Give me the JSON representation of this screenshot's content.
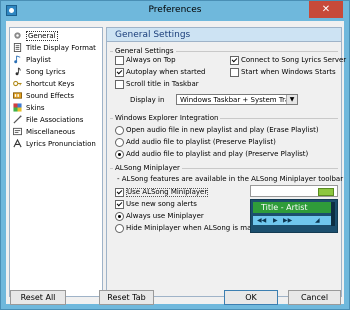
{
  "window": {
    "title": "Preferences"
  },
  "nav": {
    "items": [
      {
        "label": "General",
        "icon": "gear-icon",
        "selected": true
      },
      {
        "label": "Title Display Format",
        "icon": "document-icon"
      },
      {
        "label": "Playlist",
        "icon": "playlist-icon"
      },
      {
        "label": "Song Lyrics",
        "icon": "music-note-icon"
      },
      {
        "label": "Shortcut Keys",
        "icon": "keyboard-icon"
      },
      {
        "label": "Sound Effects",
        "icon": "speaker-icon"
      },
      {
        "label": "Skins",
        "icon": "skin-icon"
      },
      {
        "label": "File Associations",
        "icon": "file-association-icon"
      },
      {
        "label": "Miscellaneous",
        "icon": "misc-icon"
      },
      {
        "label": "Lyrics Pronunciation",
        "icon": "pronunciation-icon"
      }
    ]
  },
  "panel": {
    "title": "General Settings",
    "general": {
      "title": "General Settings",
      "always_on_top": {
        "label": "Always on Top",
        "checked": false
      },
      "autoplay": {
        "label": "Autoplay when started",
        "checked": true
      },
      "scroll_title": {
        "label": "Scroll title in Taskbar",
        "checked": false
      },
      "connect_lyrics": {
        "label": "Connect to Song Lyrics Server",
        "checked": true
      },
      "start_windows": {
        "label": "Start when Windows Starts",
        "checked": false
      },
      "display_label": "Display in",
      "display_value": "Windows Taskbar + System Tray"
    },
    "explorer": {
      "title": "Windows Explorer Integration",
      "options": [
        {
          "label": "Open audio file in new playlist and play (Erase Playlist)",
          "checked": false
        },
        {
          "label": "Add audio file to playlist (Preserve Playlist)",
          "checked": false
        },
        {
          "label": "Add audio file to playlist and play (Preserve Playlist)",
          "checked": true
        }
      ]
    },
    "miniplayer": {
      "title": "ALSong Miniplayer",
      "note": "- ALSong features are available in the ALSong Miniplayer toolbar",
      "use_mini": {
        "label": "Use ALSong Miniplayer",
        "checked": true
      },
      "use_alerts": {
        "label": "Use new song alerts",
        "checked": true
      },
      "always": {
        "label": "Always use Miniplayer",
        "checked": true
      },
      "hide_max": {
        "label": "Hide Miniplayer when ALSong is maximized",
        "checked": false
      },
      "preview_title": "Title - Artist"
    }
  },
  "buttons": {
    "reset_all": "Reset All",
    "reset_tab": "Reset Tab",
    "ok": "OK",
    "cancel": "Cancel"
  }
}
